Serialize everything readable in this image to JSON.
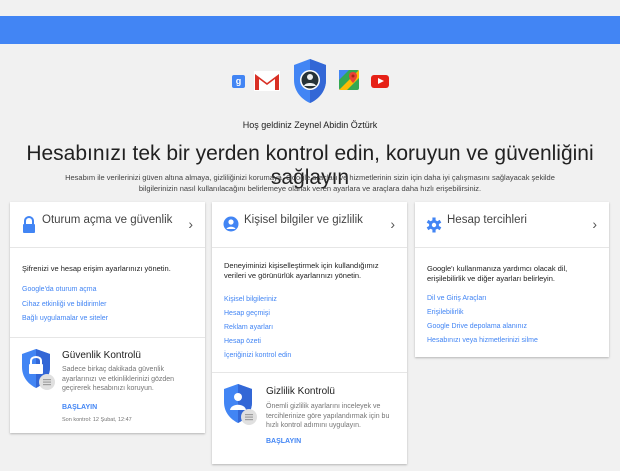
{
  "colors": {
    "brand_blue": "#4285f4",
    "background": "#f1f1f1",
    "link": "#4285f4",
    "youtube_red": "#e62117"
  },
  "apps": [
    {
      "name": "gplus-icon",
      "label": "g"
    },
    {
      "name": "gmail-icon"
    },
    {
      "name": "account-shield-icon"
    },
    {
      "name": "maps-icon"
    },
    {
      "name": "youtube-icon"
    }
  ],
  "welcome": "Hoş geldiniz Zeynel Abidin Öztürk",
  "headline": "Hesabınızı tek bir yerden kontrol edin, koruyun ve güvenliğini sağlayın",
  "intro": "Hesabım ile verilerinizi güven altına almaya, gizliliğinizi korumaya, Google araçları ve hizmetlerinin sizin için daha iyi çalışmasını sağlayacak şekilde bilgilerinizin nasıl kullanılacağını belirlemeye olanak veren ayarlara ve araçlara daha hızlı erişebilirsiniz.",
  "cards": {
    "security": {
      "title": "Oturum açma ve güvenlik",
      "chevron": "›",
      "description": "Şifrenizi ve hesap erişim ayarlarınızı yönetin.",
      "links": [
        "Google'da oturum açma",
        "Cihaz etkinliği ve bildirimler",
        "Bağlı uygulamalar ve siteler"
      ],
      "checkup": {
        "title": "Güvenlik Kontrolü",
        "description": "Sadece birkaç dakikada güvenlik ayarlarınızı ve etkinliklerinizi gözden geçirerek hesabınızı koruyun.",
        "action": "BAŞLAYIN",
        "meta": "Son kontrol: 12 Şubat, 12:47"
      }
    },
    "privacy": {
      "title": "Kişisel bilgiler ve gizlilik",
      "chevron": "›",
      "description": "Deneyiminizi kişiselleştirmek için kullandığımız verileri ve görünürlük ayarlarınızı yönetin.",
      "links": [
        "Kişisel bilgileriniz",
        "Hesap geçmişi",
        "Reklam ayarları",
        "Hesap özeti",
        "İçeriğinizi kontrol edin"
      ],
      "checkup": {
        "title": "Gizlilik Kontrolü",
        "description": "Önemli gizlilik ayarlarını inceleyek ve tercihlerinize göre yapılandırmak için bu hızlı kontrol adımını uygulayın.",
        "action": "BAŞLAYIN"
      }
    },
    "preferences": {
      "title": "Hesap tercihleri",
      "chevron": "›",
      "description": "Google'ı kullanmanıza yardımcı olacak dil, erişilebilirlik ve diğer ayarları belirleyin.",
      "links": [
        "Dil ve Giriş Araçları",
        "Erişilebilirlik",
        "Google Drive depolama alanınız",
        "Hesabınızı veya hizmetlerinizi silme"
      ]
    }
  }
}
